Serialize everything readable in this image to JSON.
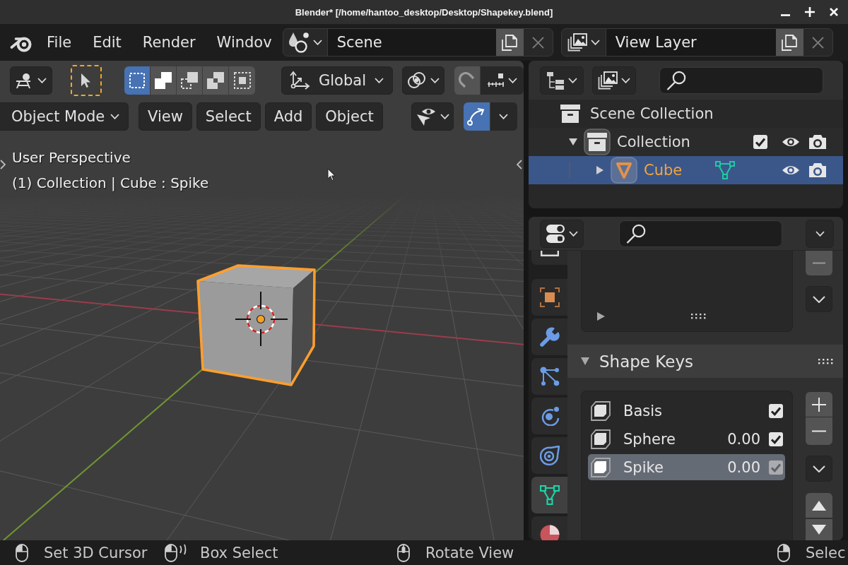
{
  "window": {
    "title": "Blender* [/home/hantoo_desktop/Desktop/Shapekey.blend]"
  },
  "menu_bar": {
    "items": [
      "File",
      "Edit",
      "Render",
      "Windov"
    ]
  },
  "scene_selector": {
    "value": "Scene"
  },
  "view_layer_selector": {
    "value": "View Layer"
  },
  "viewport": {
    "select_modes": [
      {
        "kind": "set",
        "selected": true
      },
      {
        "kind": "extend",
        "selected": false
      },
      {
        "kind": "subtract",
        "selected": false
      },
      {
        "kind": "invert",
        "selected": false
      },
      {
        "kind": "intersect",
        "selected": false
      }
    ],
    "orientation": "Global",
    "snapping": false,
    "mode": "Object Mode",
    "menus": [
      "View",
      "Select",
      "Add",
      "Object"
    ],
    "gizmos": true,
    "overlay_lines": [
      "User Perspective",
      "(1) Collection | Cube : Spike"
    ]
  },
  "outliner": {
    "tree": [
      {
        "name": "Scene Collection",
        "kind": "scene_collection",
        "selected": false,
        "children": [
          {
            "name": "Collection",
            "kind": "collection",
            "selected": false,
            "expanded": true,
            "checked": true,
            "children": [
              {
                "name": "Cube",
                "kind": "mesh_object",
                "selected": true,
                "expanded": false
              }
            ]
          }
        ]
      }
    ]
  },
  "properties": {
    "tabs": [
      {
        "kind": "frame",
        "selected": false
      },
      {
        "kind": "object",
        "selected": false
      },
      {
        "kind": "modifiers",
        "selected": false
      },
      {
        "kind": "particles",
        "selected": false
      },
      {
        "kind": "physics",
        "selected": false
      },
      {
        "kind": "constraints",
        "selected": false
      },
      {
        "kind": "data",
        "selected": true
      },
      {
        "kind": "material",
        "selected": false
      }
    ],
    "shape_keys": {
      "title": "Shape Keys",
      "expanded": true,
      "keys": [
        {
          "name": "Basis",
          "checked": true,
          "selected": false
        },
        {
          "name": "Sphere",
          "value": "0.00",
          "checked": true,
          "selected": false
        },
        {
          "name": "Spike",
          "value": "0.00",
          "checked": true,
          "selected": true
        }
      ]
    }
  },
  "status_bar": {
    "hints": [
      {
        "kind": "left_click",
        "label": "Set 3D Cursor"
      },
      {
        "kind": "left_drag",
        "label": "Box Select"
      },
      {
        "kind": "middle_click",
        "label": "Rotate View"
      },
      {
        "kind": "right_click",
        "label": "Selec"
      }
    ]
  }
}
